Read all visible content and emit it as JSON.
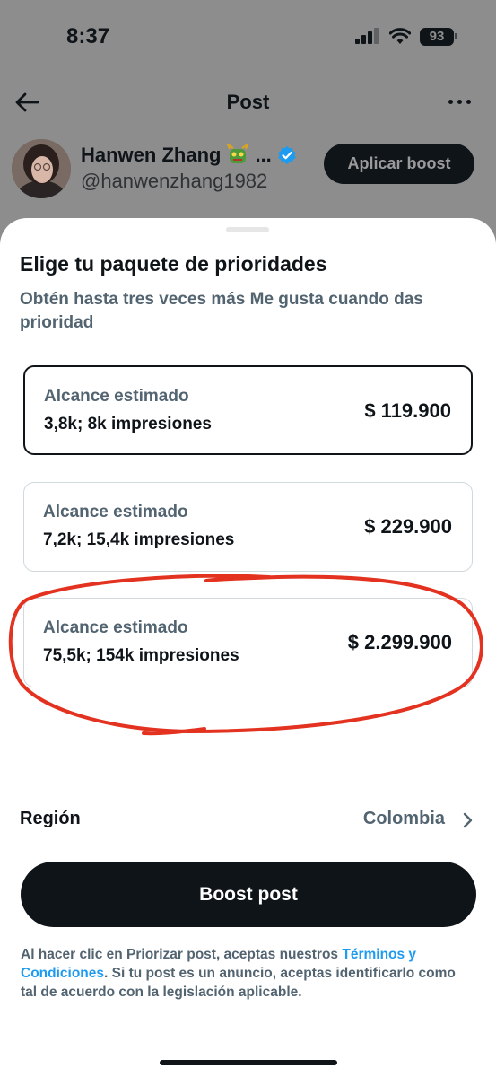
{
  "status_bar": {
    "time": "8:37",
    "battery": "93"
  },
  "header": {
    "title": "Post"
  },
  "profile": {
    "name": "Hanwen Zhang",
    "name_suffix": "...",
    "handle": "@hanwenzhang1982",
    "apply_boost_label": "Aplicar boost"
  },
  "sheet": {
    "title": "Elige tu paquete de prioridades",
    "subtitle": "Obtén hasta tres veces más Me gusta cuando das prioridad",
    "packages": [
      {
        "label": "Alcance estimado",
        "reach": "3,8k; 8k impresiones",
        "price": "$ 119.900",
        "selected": true
      },
      {
        "label": "Alcance estimado",
        "reach": "7,2k; 15,4k impresiones",
        "price": "$ 229.900",
        "selected": false
      },
      {
        "label": "Alcance estimado",
        "reach": "75,5k; 154k impresiones",
        "price": "$ 2.299.900",
        "selected": false
      }
    ],
    "region_label": "Región",
    "region_value": "Colombia",
    "boost_button": "Boost post",
    "legal": {
      "before": "Al hacer clic en Priorizar post, aceptas nuestros ",
      "link": "Términos y Condiciones",
      "after": ". Si tu post es un anuncio, aceptas identificarlo como tal de acuerdo con la legislación aplicable."
    }
  },
  "colors": {
    "accent_link": "#1d9bf0",
    "annotation_red": "#e3321f",
    "button_dark": "#0f1419"
  }
}
